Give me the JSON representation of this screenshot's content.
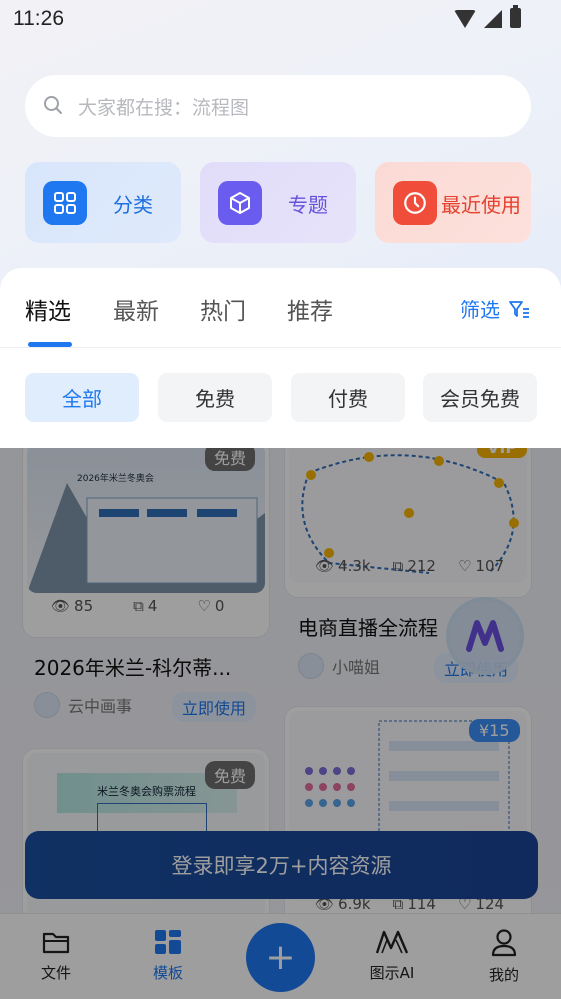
{
  "status_bar": {
    "time": "11:26"
  },
  "search": {
    "placeholder": "大家都在搜：流程图"
  },
  "quick_actions": [
    {
      "label": "分类",
      "icon": "grid-icon",
      "color": "#1f78f0"
    },
    {
      "label": "专题",
      "icon": "cube-icon",
      "color": "#6b5cf0"
    },
    {
      "label": "最近使用",
      "icon": "clock-icon",
      "color": "#f04e3a"
    }
  ],
  "tabs": [
    {
      "label": "精选",
      "active": true
    },
    {
      "label": "最新",
      "active": false
    },
    {
      "label": "热门",
      "active": false
    },
    {
      "label": "推荐",
      "active": false
    }
  ],
  "filter_label": "筛选",
  "chips": [
    {
      "label": "全部",
      "active": true
    },
    {
      "label": "免费",
      "active": false
    },
    {
      "label": "付费",
      "active": false
    },
    {
      "label": "会员免费",
      "active": false
    }
  ],
  "cards": [
    {
      "badge": "免费",
      "views": "85",
      "copies": "4",
      "likes": "0",
      "title": "2026年米兰-科尔蒂...",
      "author": "云中画事",
      "use_label": "立即使用",
      "thumb_title": "2026年米兰冬奥会"
    },
    {
      "badge": "VIP",
      "views": "4.3k",
      "copies": "212",
      "likes": "107",
      "title": "电商直播全流程",
      "author": "小喵姐",
      "use_label": "立即使用"
    },
    {
      "badge": "免费",
      "thumb_title": "米兰冬奥会购票流程"
    },
    {
      "badge": "¥15",
      "views": "6.9k",
      "copies": "114",
      "likes": "124"
    }
  ],
  "login_banner": "登录即享2万+内容资源",
  "bottom_nav": [
    {
      "label": "文件",
      "icon": "folder-icon",
      "active": false
    },
    {
      "label": "模板",
      "icon": "template-grid-icon",
      "active": true
    },
    {
      "label": "",
      "icon": "plus-icon",
      "active": false
    },
    {
      "label": "图示AI",
      "icon": "ai-logo-icon",
      "active": false
    },
    {
      "label": "我的",
      "icon": "user-icon",
      "active": false
    }
  ],
  "colors": {
    "accent": "#1f78f0",
    "panel": "#ffffff"
  }
}
